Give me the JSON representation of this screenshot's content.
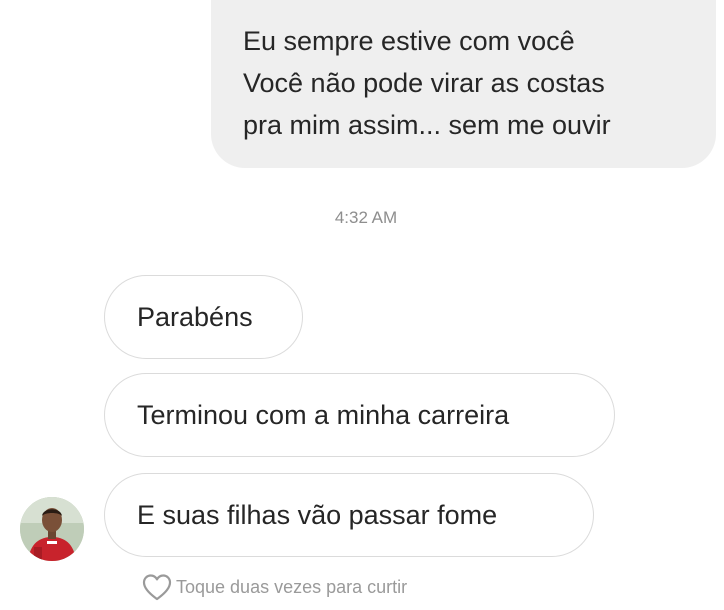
{
  "thread": {
    "sent_message": {
      "lines": [
        "Eu sempre estive com você",
        "Você não pode virar as costas",
        "pra mim assim... sem me ouvir"
      ]
    },
    "timestamp": "4:32 AM",
    "received_messages": [
      "Parabéns",
      "Terminou com a minha carreira",
      "E suas filhas vão passar fome"
    ],
    "like_hint": "Toque duas vezes para curtir",
    "icons": {
      "like": "heart-outline-icon",
      "avatar": "user-avatar"
    },
    "colors": {
      "sent_bubble": "#efefef",
      "received_border": "#dbdbdb",
      "text": "#262626",
      "muted": "#8e8e8e"
    }
  }
}
